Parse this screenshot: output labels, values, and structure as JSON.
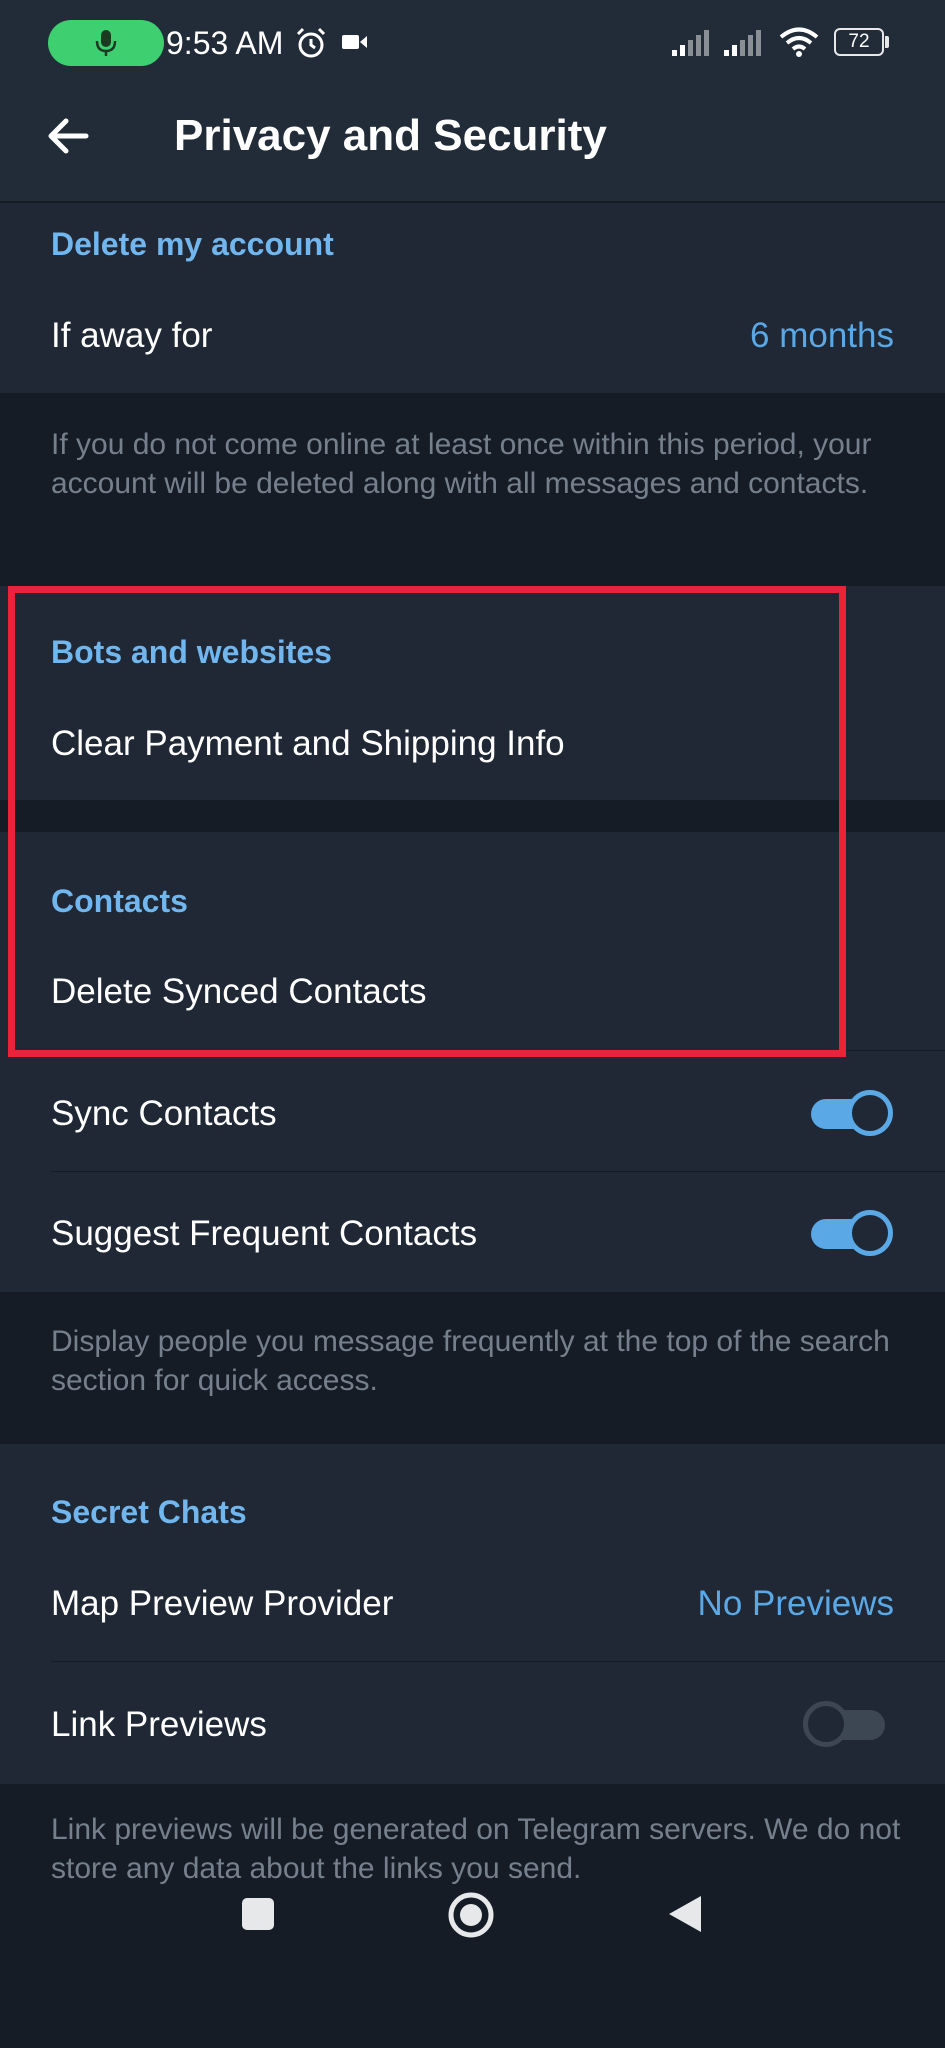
{
  "status_bar": {
    "time": "9:53 AM",
    "battery": "72",
    "icons": [
      "mic-icon",
      "alarm-icon",
      "video-icon",
      "signal-icon",
      "signal-icon",
      "wifi-icon",
      "battery-icon"
    ]
  },
  "header": {
    "title": "Privacy and Security",
    "back_icon": "arrow-left-icon"
  },
  "delete_account": {
    "title": "Delete my account",
    "row_label": "If away for",
    "row_value": "6 months",
    "hint": "If you do not come online at least once within this period, your account will be deleted along with all messages and contacts."
  },
  "bots": {
    "title": "Bots and websites",
    "row_label": "Clear Payment and Shipping Info"
  },
  "contacts": {
    "title": "Contacts",
    "delete_label": "Delete Synced Contacts",
    "sync_label": "Sync Contacts",
    "sync_on": true,
    "suggest_label": "Suggest Frequent Contacts",
    "suggest_on": true,
    "hint": "Display people you message frequently at the top of the search section for quick access."
  },
  "secret_chats": {
    "title": "Secret Chats",
    "map_label": "Map Preview Provider",
    "map_value": "No Previews",
    "link_label": "Link Previews",
    "link_on": false,
    "hint": "Link previews will be generated on Telegram servers. We do not store any data about the links you send."
  },
  "nav": {
    "icons": [
      "square-icon",
      "circle-home-icon",
      "back-triangle-icon"
    ]
  },
  "colors": {
    "accent": "#5aa8e6",
    "section_title": "#71b6ee",
    "highlight": "#e8233a",
    "background": "#151c26",
    "panel": "#1f2834"
  }
}
